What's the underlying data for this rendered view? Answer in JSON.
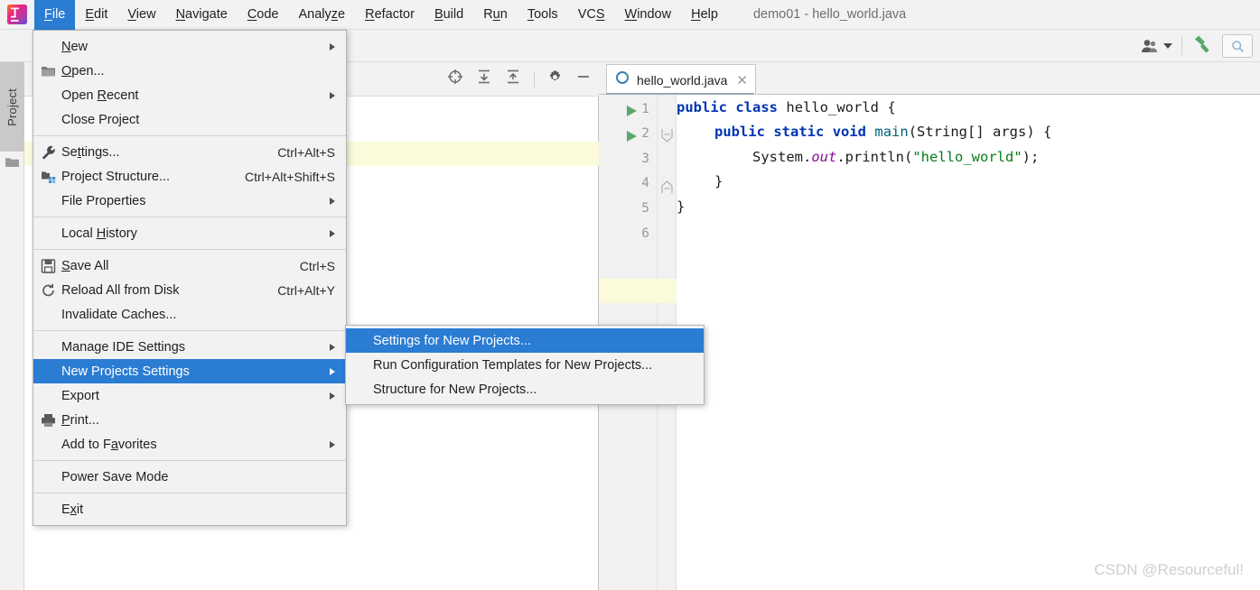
{
  "window": {
    "title": "demo01 - hello_world.java",
    "logo_icon": "intellij-idea-logo"
  },
  "menubar": {
    "items": [
      {
        "label": "File",
        "mnemonic": "F",
        "active": true
      },
      {
        "label": "Edit",
        "mnemonic": "E",
        "active": false
      },
      {
        "label": "View",
        "mnemonic": "V",
        "active": false
      },
      {
        "label": "Navigate",
        "mnemonic": "N",
        "active": false
      },
      {
        "label": "Code",
        "mnemonic": "C",
        "active": false
      },
      {
        "label": "Analyze",
        "mnemonic": "z",
        "active": false
      },
      {
        "label": "Refactor",
        "mnemonic": "R",
        "active": false
      },
      {
        "label": "Build",
        "mnemonic": "B",
        "active": false
      },
      {
        "label": "Run",
        "mnemonic": "u",
        "active": false
      },
      {
        "label": "Tools",
        "mnemonic": "T",
        "active": false
      },
      {
        "label": "VCS",
        "mnemonic": "S",
        "active": false
      },
      {
        "label": "Window",
        "mnemonic": "W",
        "active": false
      },
      {
        "label": "Help",
        "mnemonic": "H",
        "active": false
      }
    ]
  },
  "toolbar": {
    "user_icon": "user-account-icon",
    "user_dropdown_icon": "chevron-down-icon",
    "build_icon": "hammer-build-icon",
    "search_icon": "search-everywhere-icon"
  },
  "left_strip": {
    "project_tab_label": "Project",
    "project_tab_icon": "folder-icon"
  },
  "project_panel": {
    "toolbar_icons": [
      "locate-target-icon",
      "expand-all-icon",
      "collapse-all-icon",
      "settings-gear-icon",
      "hide-panel-icon"
    ]
  },
  "file_menu": {
    "groups": [
      [
        {
          "label": "New",
          "pre": "N",
          "post": "ew",
          "icon": null,
          "shortcut": null,
          "submenu": true,
          "selected": false
        },
        {
          "label": "Open...",
          "pre": "O",
          "post": "pen...",
          "icon": "folder-open-icon",
          "shortcut": null,
          "submenu": false,
          "selected": false
        },
        {
          "label": "Open Recent",
          "pre": "Open ",
          "post": "Recent",
          "icon": null,
          "shortcut": null,
          "submenu": true,
          "selected": false,
          "mnemonic_mid": "R"
        },
        {
          "label": "Close Project",
          "pre": null,
          "post": "Close Project",
          "icon": null,
          "shortcut": null,
          "submenu": false,
          "selected": false
        }
      ],
      [
        {
          "label": "Settings...",
          "pre": "Se",
          "post": "ttings...",
          "icon": "wrench-icon",
          "shortcut": "Ctrl+Alt+S",
          "submenu": false,
          "selected": false,
          "mnemonic_mid": "t"
        },
        {
          "label": "Project Structure...",
          "pre": null,
          "post": "Project Structure...",
          "icon": "project-structure-icon",
          "shortcut": "Ctrl+Alt+Shift+S",
          "submenu": false,
          "selected": false
        },
        {
          "label": "File Properties",
          "pre": null,
          "post": "File Properties",
          "icon": null,
          "shortcut": null,
          "submenu": true,
          "selected": false
        }
      ],
      [
        {
          "label": "Local History",
          "pre": "Local ",
          "post": "istory",
          "icon": null,
          "shortcut": null,
          "submenu": true,
          "selected": false,
          "mnemonic_mid": "H"
        }
      ],
      [
        {
          "label": "Save All",
          "pre": "S",
          "post": "ave All",
          "icon": "save-floppy-icon",
          "shortcut": "Ctrl+S",
          "submenu": false,
          "selected": false
        },
        {
          "label": "Reload All from Disk",
          "pre": null,
          "post": "Reload All from Disk",
          "icon": "reload-icon",
          "shortcut": "Ctrl+Alt+Y",
          "submenu": false,
          "selected": false
        },
        {
          "label": "Invalidate Caches...",
          "pre": null,
          "post": "Invalidate Caches...",
          "icon": null,
          "shortcut": null,
          "submenu": false,
          "selected": false
        }
      ],
      [
        {
          "label": "Manage IDE Settings",
          "pre": null,
          "post": "Manage IDE Settings",
          "icon": null,
          "shortcut": null,
          "submenu": true,
          "selected": false
        },
        {
          "label": "New Projects Settings",
          "pre": null,
          "post": "New Projects Settings",
          "icon": null,
          "shortcut": null,
          "submenu": true,
          "selected": true
        },
        {
          "label": "Export",
          "pre": null,
          "post": "Export",
          "icon": null,
          "shortcut": null,
          "submenu": true,
          "selected": false
        },
        {
          "label": "Print...",
          "pre": "P",
          "post": "rint...",
          "icon": "printer-icon",
          "shortcut": null,
          "submenu": false,
          "selected": false
        },
        {
          "label": "Add to Favorites",
          "pre": "Add to F",
          "post": "avorites",
          "icon": null,
          "shortcut": null,
          "submenu": true,
          "selected": false,
          "mnemonic_mid": "a"
        }
      ],
      [
        {
          "label": "Power Save Mode",
          "pre": null,
          "post": "Power Save Mode",
          "icon": null,
          "shortcut": null,
          "submenu": false,
          "selected": false
        }
      ],
      [
        {
          "label": "Exit",
          "pre": "E",
          "post": "it",
          "icon": null,
          "shortcut": null,
          "submenu": false,
          "selected": false,
          "mnemonic_mid": "x"
        }
      ]
    ]
  },
  "submenu": {
    "title": "New Projects Settings",
    "items": [
      {
        "label": "Settings for New Projects...",
        "selected": true
      },
      {
        "label": "Run Configuration Templates for New Projects...",
        "selected": false
      },
      {
        "label": "Structure for New Projects...",
        "selected": false
      }
    ]
  },
  "editor": {
    "tab": {
      "label": "hello_world.java",
      "file_icon": "java-class-icon",
      "close_icon": "close-x-icon"
    },
    "lines": [
      {
        "num": "1",
        "run_marker": true,
        "fold": null,
        "indent": 0
      },
      {
        "num": "2",
        "run_marker": true,
        "fold": "open",
        "indent": 1
      },
      {
        "num": "3",
        "run_marker": false,
        "fold": null,
        "indent": 2
      },
      {
        "num": "4",
        "run_marker": false,
        "fold": "close",
        "indent": 1
      },
      {
        "num": "5",
        "run_marker": false,
        "fold": null,
        "indent": 0
      },
      {
        "num": "6",
        "run_marker": false,
        "fold": null,
        "indent": 0
      }
    ],
    "code": {
      "l1_k1": "public",
      "l1_k2": "class",
      "l1_name": "hello_world",
      "l1_brace": "{",
      "l2_k1": "public",
      "l2_k2": "static",
      "l2_k3": "void",
      "l2_name": "main",
      "l2_args": "(String[] args) {",
      "l3_sys": "System.",
      "l3_out": "out",
      "l3_dot": ".",
      "l3_println": "println",
      "l3_open": "(",
      "l3_str": "\"hello_world\"",
      "l3_close": ");",
      "l4_brace": "}",
      "l5_brace": "}",
      "l6_text": ""
    },
    "current_line": "6"
  },
  "watermark": {
    "text": "CSDN @Resourceful!"
  },
  "colors": {
    "accent_blue": "#2b7cd3",
    "menu_bg": "#f2f2f2",
    "keyword": "#0033b3",
    "string": "#067d17",
    "field": "#871094",
    "method": "#00627a",
    "highlight_row": "#fbfbdc",
    "run_green": "#59a869"
  }
}
